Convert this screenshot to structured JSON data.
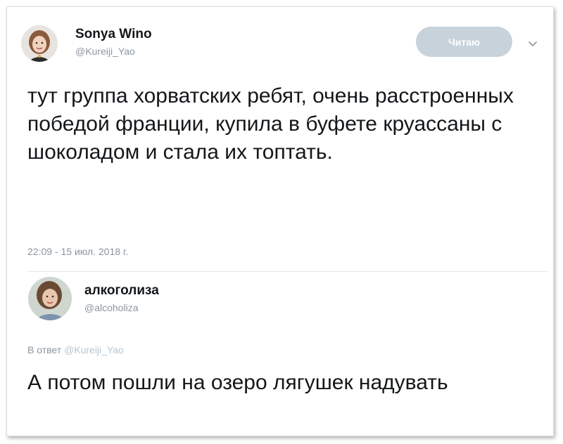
{
  "tweet": {
    "author_name": "Sonya Wino",
    "author_handle": "@Kureiji_Yao",
    "follow_button_label": "Читаю",
    "chevron_icon": "chevron-down-icon",
    "text": "тут группа хорватских ребят, очень расстроенных победой франции, купила в буфете круассаны с шоколадом и стала их топтать.",
    "timestamp": "22:09 - 15 июл. 2018 г."
  },
  "reply": {
    "author_name": "алкоголиза",
    "author_handle": "@alcoholiza",
    "reply_prefix": "В ответ",
    "reply_to_handle": "@Kureiji_Yao",
    "text": "А потом пошли на озеро лягушек надувать"
  },
  "colors": {
    "follow_button_bg": "#c7d2db",
    "secondary_text": "#8a959e",
    "divider": "#e1e8ed"
  }
}
